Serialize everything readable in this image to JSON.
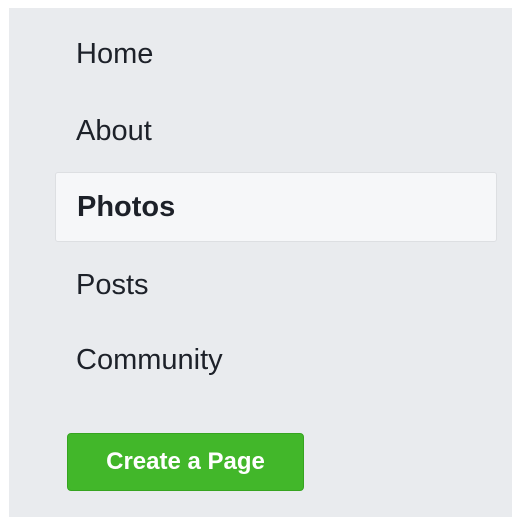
{
  "nav": {
    "items": [
      {
        "label": "Home",
        "active": false
      },
      {
        "label": "About",
        "active": false
      },
      {
        "label": "Photos",
        "active": true
      },
      {
        "label": "Posts",
        "active": false
      },
      {
        "label": "Community",
        "active": false
      }
    ]
  },
  "create_button": {
    "label": "Create a Page",
    "color": "#42b72a"
  },
  "colors": {
    "panel_background": "#e9ebee",
    "active_item_background": "#f6f7f9",
    "text": "#1d2129"
  }
}
